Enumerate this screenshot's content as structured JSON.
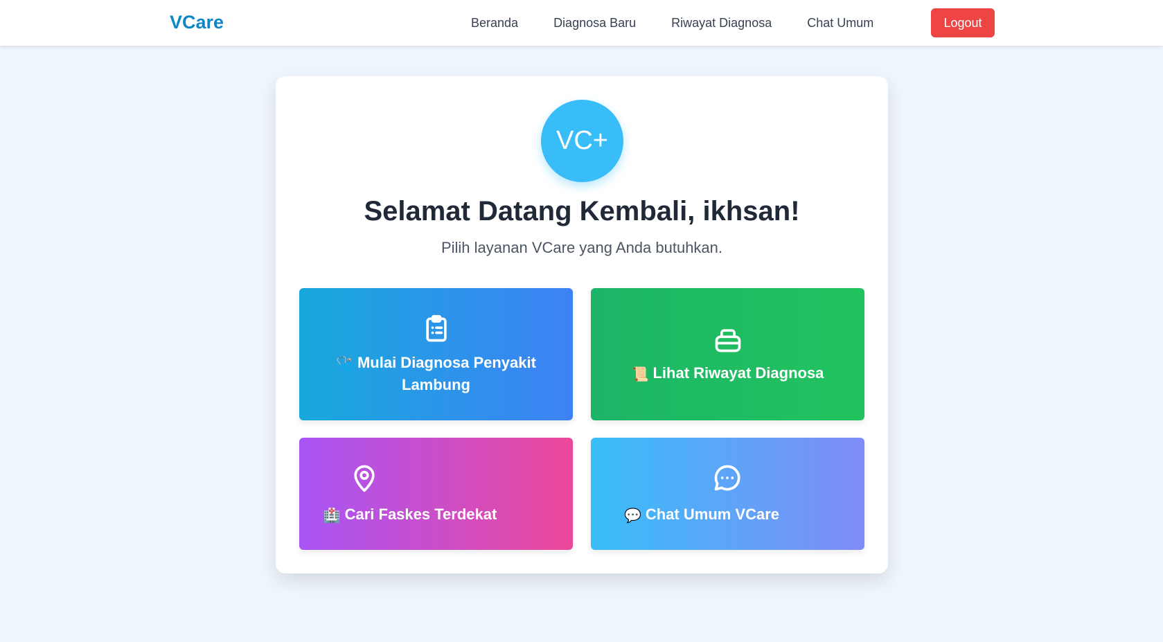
{
  "navbar": {
    "brand": "VCare",
    "links": [
      "Beranda",
      "Diagnosa Baru",
      "Riwayat Diagnosa",
      "Chat Umum"
    ],
    "logout_label": "Logout"
  },
  "welcome": {
    "logo_text": "VC+",
    "title": "Selamat Datang Kembali, ikhsan!",
    "subtitle": "Pilih layanan VCare yang Anda butuhkan."
  },
  "tiles": [
    {
      "label": "Mulai Diagnosa Penyakit Lambung",
      "emoji": "🩺",
      "icon": "clipboard-list-icon",
      "gradient": [
        "#18a9dc",
        "#3d82f5"
      ]
    },
    {
      "label": "Lihat Riwayat Diagnosa",
      "emoji": "📜",
      "icon": "archive-box-icon",
      "gradient": [
        "#1cb567",
        "#22c35e"
      ]
    },
    {
      "label": "Cari Faskes Terdekat",
      "emoji": "🏥",
      "icon": "map-pin-icon",
      "gradient": [
        "#a855f7",
        "#ec4899"
      ]
    },
    {
      "label": "Chat Umum VCare",
      "emoji": "💬",
      "icon": "chat-bubble-icon",
      "gradient": [
        "#38bdf8",
        "#818cf8"
      ]
    }
  ],
  "colors": {
    "brand": "#0e86c8",
    "logout": "#ef4444",
    "logo_circle": "#38bdf8",
    "page_background": "#f0f6fd"
  }
}
